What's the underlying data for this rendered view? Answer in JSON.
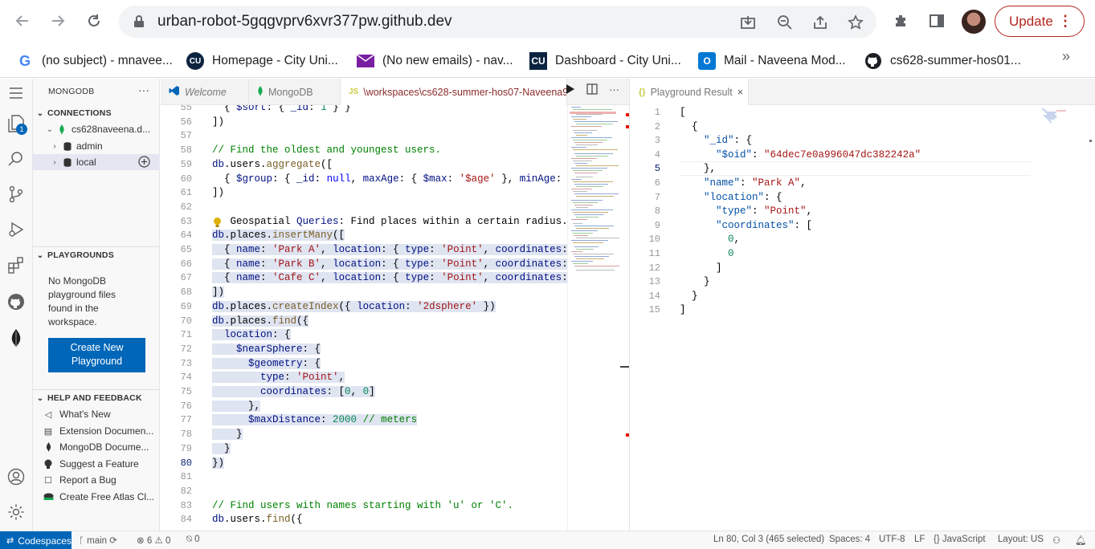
{
  "browser": {
    "url": "urban-robot-5gqgvprv6xvr377pw.github.dev",
    "update_label": "Update",
    "bookmarks": [
      {
        "label": "(no subject) - mnavee..."
      },
      {
        "label": "Homepage - City Uni..."
      },
      {
        "label": "(No new emails) - nav..."
      },
      {
        "label": "Dashboard - City Uni..."
      },
      {
        "label": "Mail - Naveena Mod..."
      },
      {
        "label": "cs628-summer-hos01..."
      }
    ],
    "bookmark_more": "»"
  },
  "activity": {
    "badge": "1"
  },
  "sidebar": {
    "title": "MONGODB",
    "more": "···",
    "connections_header": "CONNECTIONS",
    "connection_name": "cs628naveena.d...",
    "databases": [
      "admin",
      "local"
    ],
    "playgrounds_header": "PLAYGROUNDS",
    "playgrounds_empty": [
      "No MongoDB",
      "playground files",
      "found in the",
      "workspace."
    ],
    "create_button": [
      "Create New",
      "Playground"
    ],
    "help_header": "HELP AND FEEDBACK",
    "help_items": [
      "What's New",
      "Extension Documen...",
      "MongoDB Docume...",
      "Suggest a Feature",
      "Report a Bug",
      "Create Free Atlas Cl..."
    ]
  },
  "tabs": [
    {
      "label": "Welcome"
    },
    {
      "label": "MongoDB"
    },
    {
      "label": "\\workspaces\\cs628-summer-hos07-Naveena9",
      "icon": "JS"
    }
  ],
  "result_tab": {
    "label": "Playground Result",
    "icon": "{}"
  },
  "editor": {
    "lines": [
      {
        "n": "55",
        "html": "  { $sort: { _id: 1 } }"
      },
      {
        "n": "56",
        "html": "])"
      },
      {
        "n": "57",
        "html": ""
      },
      {
        "n": "58",
        "html": "// Find the oldest and youngest users."
      },
      {
        "n": "59",
        "html": "db.users.aggregate(["
      },
      {
        "n": "60",
        "html": "  { $group: { _id: null, maxAge: { $max: '$age' }, minAge: {"
      },
      {
        "n": "61",
        "html": "])"
      },
      {
        "n": "62",
        "html": ""
      },
      {
        "n": "63",
        "html": "   Geospatial Queries: Find places within a certain radius."
      },
      {
        "n": "64",
        "html": "db.places.insertMany(["
      },
      {
        "n": "65",
        "html": "  { name: 'Park A', location: { type: 'Point', coordinates: ["
      },
      {
        "n": "66",
        "html": "  { name: 'Park B', location: { type: 'Point', coordinates: ["
      },
      {
        "n": "67",
        "html": "  { name: 'Cafe C', location: { type: 'Point', coordinates: ["
      },
      {
        "n": "68",
        "html": "])"
      },
      {
        "n": "69",
        "html": "db.places.createIndex({ location: '2dsphere' })"
      },
      {
        "n": "70",
        "html": "db.places.find({"
      },
      {
        "n": "71",
        "html": "  location: {"
      },
      {
        "n": "72",
        "html": "    $nearSphere: {"
      },
      {
        "n": "73",
        "html": "      $geometry: {"
      },
      {
        "n": "74",
        "html": "        type: 'Point',"
      },
      {
        "n": "75",
        "html": "        coordinates: [0, 0]"
      },
      {
        "n": "76",
        "html": "      },"
      },
      {
        "n": "77",
        "html": "      $maxDistance: 2000 // meters"
      },
      {
        "n": "78",
        "html": "    }"
      },
      {
        "n": "79",
        "html": "  }"
      },
      {
        "n": "80",
        "html": "})"
      },
      {
        "n": "81",
        "html": ""
      },
      {
        "n": "82",
        "html": ""
      },
      {
        "n": "83",
        "html": "// Find users with names starting with 'u' or 'C'."
      },
      {
        "n": "84",
        "html": "db.users.find({"
      }
    ]
  },
  "result": {
    "lines": [
      {
        "n": "1",
        "text": "["
      },
      {
        "n": "2",
        "text": "  {"
      },
      {
        "n": "3",
        "text": "    \"_id\": {"
      },
      {
        "n": "4",
        "text": "      \"$oid\": \"64dec7e0a996047dc382242a\""
      },
      {
        "n": "5",
        "text": "    },"
      },
      {
        "n": "6",
        "text": "    \"name\": \"Park A\","
      },
      {
        "n": "7",
        "text": "    \"location\": {"
      },
      {
        "n": "8",
        "text": "      \"type\": \"Point\","
      },
      {
        "n": "9",
        "text": "      \"coordinates\": ["
      },
      {
        "n": "10",
        "text": "        0,"
      },
      {
        "n": "11",
        "text": "        0"
      },
      {
        "n": "12",
        "text": "      ]"
      },
      {
        "n": "13",
        "text": "    }"
      },
      {
        "n": "14",
        "text": "  }"
      },
      {
        "n": "15",
        "text": "]"
      }
    ]
  },
  "statusbar": {
    "remote": "Codespaces",
    "branch": "main",
    "errors": "6",
    "warnings": "0",
    "ports": "0",
    "position": "Ln 80, Col 3 (465 selected)",
    "spaces": "Spaces: 4",
    "encoding": "UTF-8",
    "eol": "LF",
    "language": "JavaScript",
    "layout": "Layout: US"
  }
}
